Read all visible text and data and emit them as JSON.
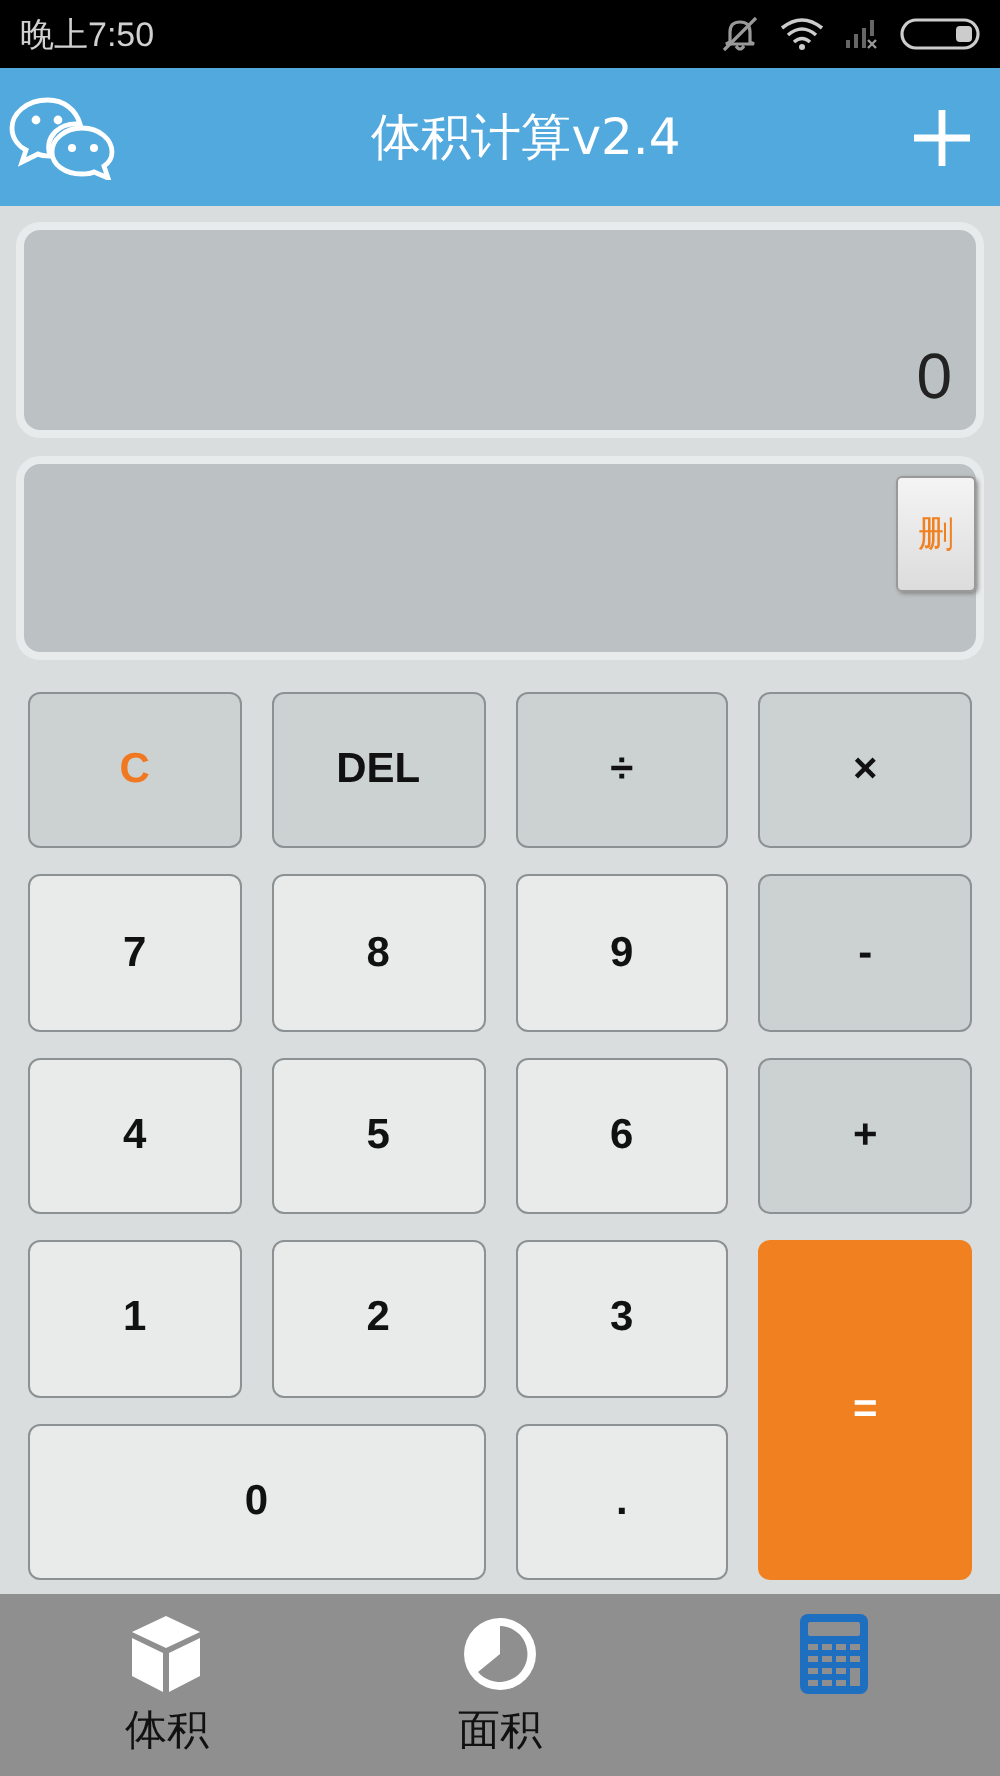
{
  "status_bar": {
    "time": "晚上7:50"
  },
  "app_bar": {
    "title": "体积计算v2.4"
  },
  "display": {
    "result": "0",
    "delete_button": "删"
  },
  "keys": [
    {
      "label": "C",
      "kind": "clear"
    },
    {
      "label": "DEL",
      "kind": "op"
    },
    {
      "label": "÷",
      "kind": "op"
    },
    {
      "label": "×",
      "kind": "op"
    },
    {
      "label": "7",
      "kind": "digit"
    },
    {
      "label": "8",
      "kind": "digit"
    },
    {
      "label": "9",
      "kind": "digit"
    },
    {
      "label": "-",
      "kind": "op"
    },
    {
      "label": "4",
      "kind": "digit"
    },
    {
      "label": "5",
      "kind": "digit"
    },
    {
      "label": "6",
      "kind": "digit"
    },
    {
      "label": "+",
      "kind": "op"
    },
    {
      "label": "1",
      "kind": "digit"
    },
    {
      "label": "2",
      "kind": "digit"
    },
    {
      "label": "3",
      "kind": "digit"
    },
    {
      "label": "=",
      "kind": "equals"
    },
    {
      "label": "0",
      "kind": "zero"
    },
    {
      "label": ".",
      "kind": "digit"
    }
  ],
  "tabs": [
    {
      "label": "体积",
      "kind": "cube",
      "selected": false
    },
    {
      "label": "面积",
      "kind": "pie",
      "selected": false
    },
    {
      "kind": "calculator",
      "selected": true
    }
  ]
}
